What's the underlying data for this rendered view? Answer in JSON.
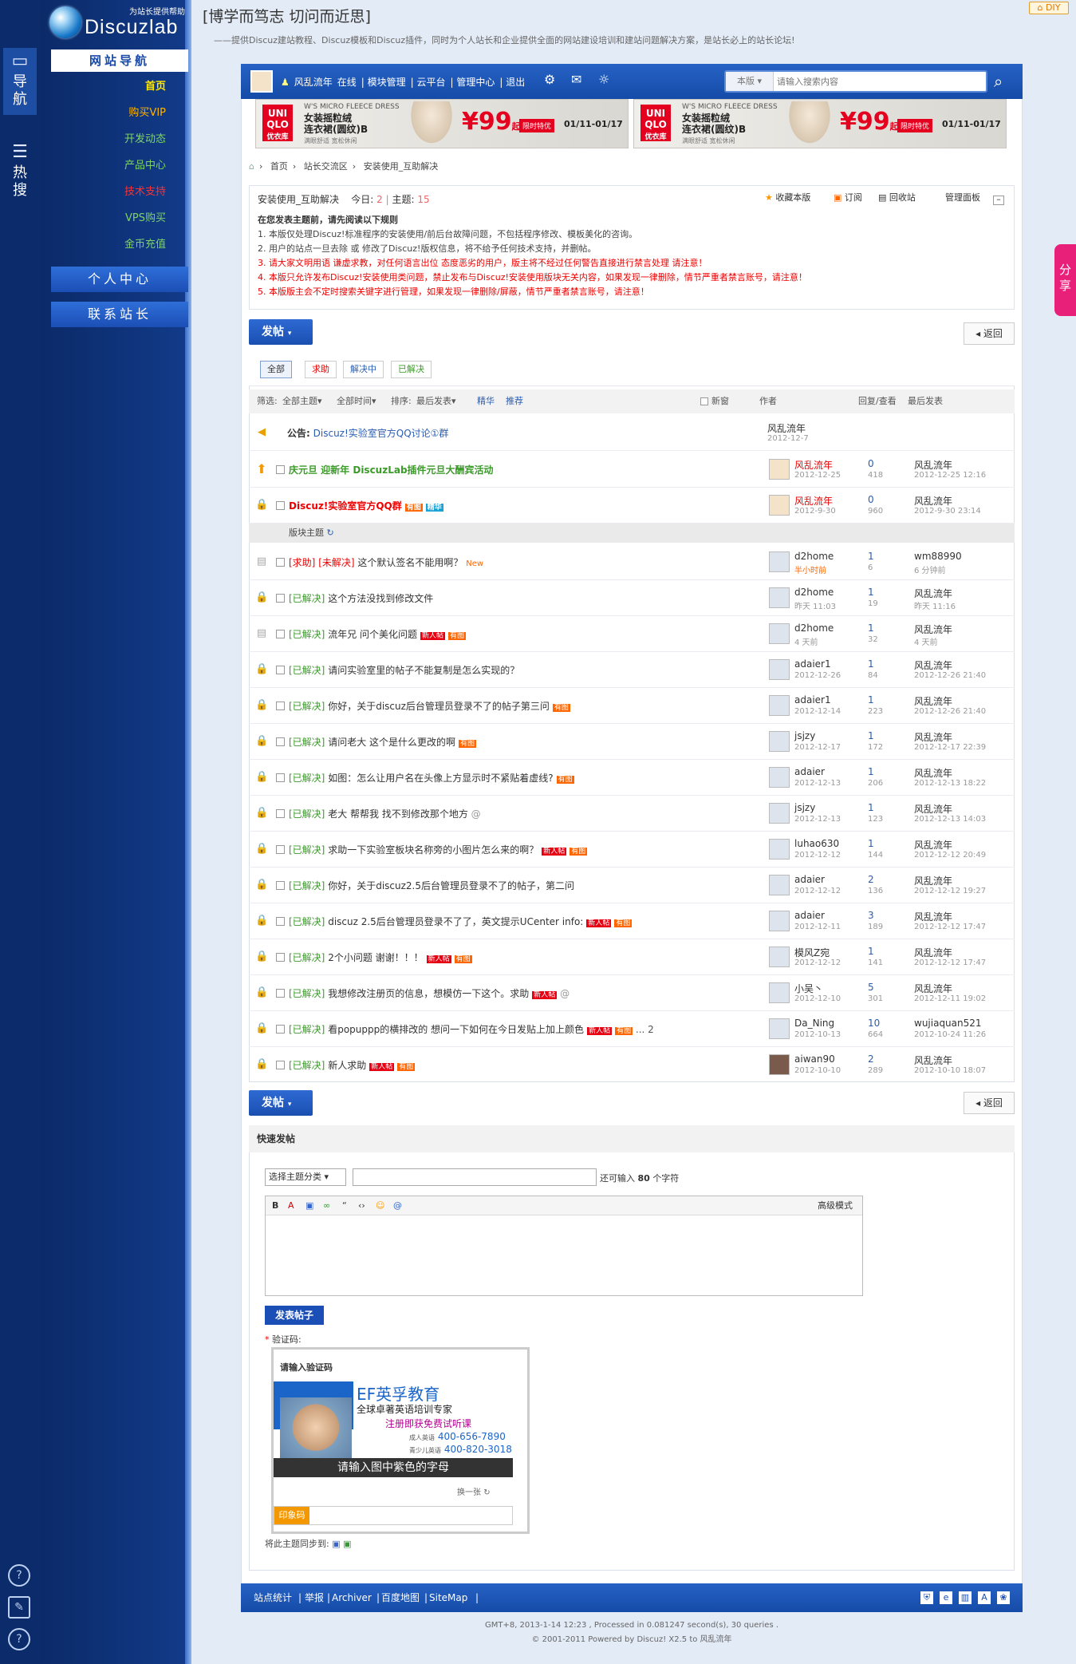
{
  "rail": {
    "nav": "导航",
    "hot": "热搜"
  },
  "logo": {
    "name": "Discuzlab",
    "tag": "为站长提供帮助"
  },
  "nav": {
    "heading": "网站导航",
    "items": [
      "首页",
      "购买VIP",
      "开发动态",
      "产品中心",
      "技术支持",
      "VPS购买",
      "金币充值"
    ],
    "user_center": "个人中心",
    "contact": "联系站长"
  },
  "header": {
    "title": "[博学而笃志 切问而近思]",
    "subtitle": "——提供Discuz建站教程、Discuz模板和Discuz插件，同时为个人站长和企业提供全面的网站建设培训和建站问题解决方案，是站长必上的站长论坛!",
    "diy": "DIY",
    "share": "分享"
  },
  "topbar": {
    "user": "风乱流年",
    "online": "在线",
    "links": [
      "模块管理",
      "云平台",
      "管理中心",
      "退出"
    ],
    "search_scope": "本版",
    "search_placeholder": "请输入搜索内容"
  },
  "ads": [
    {
      "brand": "UNI QLO",
      "brand_cn": "优衣库",
      "line1": "W'S MICRO FLEECE DRESS",
      "line2": "女装摇粒绒",
      "line3": "连衣裙(圆纹)B",
      "line4": "满眼舒适 宽松休闲",
      "price": "¥99",
      "price_unit": "起",
      "limit": "限时特优",
      "date": "01/11-01/17"
    },
    {
      "brand": "UNI QLO",
      "brand_cn": "优衣库",
      "line1": "W'S MICRO FLEECE DRESS",
      "line2": "女装摇粒绒",
      "line3": "连衣裙(圆纹)B",
      "line4": "满眼舒适 宽松休闲",
      "price": "¥99",
      "price_unit": "起",
      "limit": "限时特优",
      "date": "01/11-01/17"
    }
  ],
  "breadcrumb": [
    "首页",
    "站长交流区",
    "安装使用_互助解决"
  ],
  "forum": {
    "name": "安装使用_互助解决",
    "today_label": "今日:",
    "today": "2",
    "threads_label": "主题:",
    "threads": "15",
    "actions": [
      "收藏本版",
      "订阅",
      "回收站",
      "管理面板"
    ],
    "rules_title": "在您发表主题前，请先阅读以下规则",
    "rules": [
      "1. 本版仅处理Discuz!标准程序的安装使用/前后台故障问题，不包括程序修改、模板美化的咨询。",
      "2. 用户的站点一旦去除 或 修改了Discuz!版权信息，将不给予任何技术支持，并删帖。",
      "3. 请大家文明用语 谦虚求教，对任何语言出位 态度恶劣的用户，版主将不经过任何警告直接进行禁言处理 请注意！",
      "4. 本版只允许发布Discuz!安装使用类问题，禁止发布与Discuz!安装使用版块无关内容，如果发现一律删除，情节严重者禁言账号，请注意！",
      "5. 本版版主会不定时搜索关键字进行管理，如果发现一律删除/屏蔽，情节严重者禁言账号，请注意！"
    ]
  },
  "post_btn": "发帖",
  "back_btn": "返回",
  "types": [
    "全部",
    "求助",
    "解决中",
    "已解决"
  ],
  "sortbar": {
    "filter": "筛选:",
    "all_threads": "全部主题",
    "all_time": "全部时间",
    "sort": "排序:",
    "latest": "最后发表",
    "digest": "精华",
    "recommend": "推荐",
    "new_window": "新窗",
    "author": "作者",
    "replies": "回复/查看",
    "last": "最后发表"
  },
  "announcement": {
    "label": "公告:",
    "title": "Discuz!实验室官方QQ讨论①群",
    "author": "风乱流年",
    "date": "2012-12-7"
  },
  "sticky": [
    {
      "title": "庆元旦 迎新年 DiscuzLab插件元旦大酬宾活动",
      "author": "风乱流年",
      "date": "2012-12-25",
      "replies": "0",
      "views": "418",
      "last_user": "风乱流年",
      "last_date": "2012-12-25 12:16"
    },
    {
      "title": "Discuz!实验室官方QQ群",
      "tag1": "有图",
      "tag2": "精华",
      "author": "风乱流年",
      "date": "2012-9-30",
      "replies": "0",
      "views": "960",
      "last_user": "风乱流年",
      "last_date": "2012-9-30 23:14"
    }
  ],
  "section_label": "版块主题",
  "threads": [
    {
      "tag": "[求助]",
      "tag2": "[未解决]",
      "title": "这个默认签名不能用啊？",
      "extra": "New",
      "author": "d2home",
      "date": "半小时前",
      "replies": "1",
      "views": "6",
      "last_user": "wm88990",
      "last_date": "6 分钟前"
    },
    {
      "tag": "[已解决]",
      "title": "这个方法没找到修改文件",
      "author": "d2home",
      "date": "昨天 11:03",
      "replies": "1",
      "views": "19",
      "last_user": "风乱流年",
      "last_date": "昨天 11:16"
    },
    {
      "tag": "[已解决]",
      "title": "流年兄 问个美化问题",
      "new": "新人帖",
      "img": "有图",
      "author": "d2home",
      "date": "4 天前",
      "replies": "1",
      "views": "32",
      "last_user": "风乱流年",
      "last_date": "4 天前"
    },
    {
      "tag": "[已解决]",
      "title": "请问实验室里的帖子不能复制是怎么实现的？",
      "author": "adaier1",
      "date": "2012-12-26",
      "replies": "1",
      "views": "84",
      "last_user": "风乱流年",
      "last_date": "2012-12-26 21:40"
    },
    {
      "tag": "[已解决]",
      "title": "你好，关于discuz后台管理员登录不了的帖子第三问",
      "img": "有图",
      "author": "adaier1",
      "date": "2012-12-14",
      "replies": "1",
      "views": "223",
      "last_user": "风乱流年",
      "last_date": "2012-12-26 21:40"
    },
    {
      "tag": "[已解决]",
      "title": "请问老大 这个是什么更改的啊",
      "img": "有图",
      "author": "jsjzy",
      "date": "2012-12-17",
      "replies": "1",
      "views": "172",
      "last_user": "风乱流年",
      "last_date": "2012-12-17 22:39"
    },
    {
      "tag": "[已解决]",
      "title": "如图：怎么让用户名在头像上方显示时不紧贴着虚线?",
      "img": "有图",
      "author": "adaier",
      "date": "2012-12-13",
      "replies": "1",
      "views": "206",
      "last_user": "风乱流年",
      "last_date": "2012-12-13 18:22"
    },
    {
      "tag": "[已解决]",
      "title": "老大 帮帮我 找不到修改那个地方",
      "author": "jsjzy",
      "date": "2012-12-13",
      "replies": "1",
      "views": "123",
      "last_user": "风乱流年",
      "last_date": "2012-12-13 14:03"
    },
    {
      "tag": "[已解决]",
      "title": "求助一下实验室板块名称旁的小图片怎么来的啊？",
      "new": "新人帖",
      "img": "有图",
      "author": "luhao630",
      "date": "2012-12-12",
      "replies": "1",
      "views": "144",
      "last_user": "风乱流年",
      "last_date": "2012-12-12 20:49"
    },
    {
      "tag": "[已解决]",
      "title": "你好，关于discuz2.5后台管理员登录不了的帖子，第二问",
      "author": "adaier",
      "date": "2012-12-12",
      "replies": "2",
      "views": "136",
      "last_user": "风乱流年",
      "last_date": "2012-12-12 19:27"
    },
    {
      "tag": "[已解决]",
      "title": "discuz 2.5后台管理员登录不了了，英文提示UCenter info:",
      "new": "新人帖",
      "img": "有图",
      "author": "adaier",
      "date": "2012-12-11",
      "replies": "3",
      "views": "189",
      "last_user": "风乱流年",
      "last_date": "2012-12-12 17:47"
    },
    {
      "tag": "[已解决]",
      "title": "2个小问题 谢谢！！！",
      "new": "新人帖",
      "img": "有图",
      "author": "模风Z宛",
      "date": "2012-12-12",
      "replies": "1",
      "views": "141",
      "last_user": "风乱流年",
      "last_date": "2012-12-12 17:47"
    },
    {
      "tag": "[已解决]",
      "title": "我想修改注册页的信息，想模仿一下这个。求助",
      "new": "新人帖",
      "author": "小吴丶",
      "date": "2012-12-10",
      "replies": "5",
      "views": "301",
      "last_user": "风乱流年",
      "last_date": "2012-12-11 19:02"
    },
    {
      "tag": "[已解决]",
      "title": "看popuppp的横排改的 想问一下如何在今日发贴上加上颜色",
      "new": "新人帖",
      "img": "有图",
      "extra": "... 2",
      "author": "Da_Ning",
      "date": "2012-10-13",
      "replies": "10",
      "views": "664",
      "last_user": "wujiaquan521",
      "last_date": "2012-10-24 11:26"
    },
    {
      "tag": "[已解决]",
      "title": "新人求助",
      "new": "新人帖",
      "img": "有图",
      "author": "aiwan90",
      "date": "2012-10-10",
      "replies": "2",
      "views": "289",
      "last_user": "风乱流年",
      "last_date": "2012-10-10 18:07"
    }
  ],
  "quick": {
    "heading": "快速发帖",
    "category": "选择主题分类",
    "remain": "还可输入",
    "remain_count": "80",
    "remain_unit": "个字符",
    "advanced": "高级模式",
    "submit": "发表帖子",
    "captcha_label": "验证码:",
    "captcha_title": "请输入验证码",
    "ef_name": "EF英孚教育",
    "ef_line1": "全球卓著英语培训专家",
    "ef_line2": "注册即获免费试听课",
    "ef_tel1_label": "成人英语",
    "ef_tel1": "400-656-7890",
    "ef_tel2_label": "青少儿英语",
    "ef_tel2": "400-820-3018",
    "ef_prompt": "请输入图中紫色的字母",
    "refresh": "换一张",
    "seal": "印象码",
    "sync": "将此主题同步到:"
  },
  "footer": {
    "links": [
      "站点统计",
      "举报",
      "Archiver",
      "百度地图",
      "SiteMap"
    ]
  },
  "copyright": {
    "line1": "GMT+8, 2013-1-14 12:23 , Processed in 0.081247 second(s), 30 queries .",
    "line2": "© 2001-2011 Powered by Discuz! X2.5 to 风乱流年"
  },
  "colors": {
    "primary": "#1b4fb5",
    "nav_bg": "#0c2b6b",
    "solved": "#3a9b28",
    "alert": "#e60012",
    "accent": "#f60"
  }
}
